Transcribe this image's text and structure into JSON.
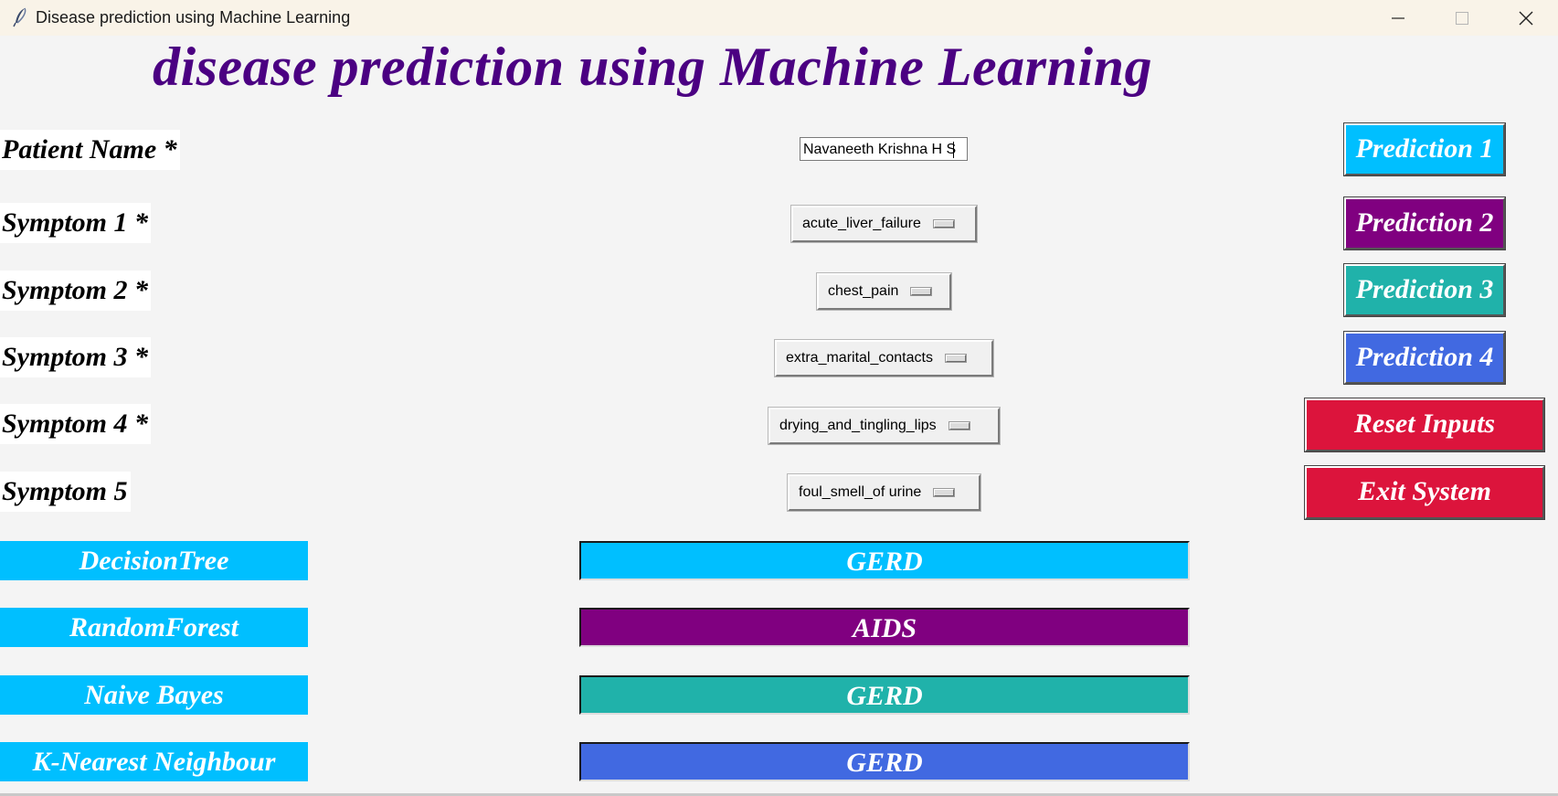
{
  "window": {
    "title": "Disease prediction using Machine Learning",
    "icon": "feather-icon"
  },
  "heading": "disease prediction using Machine Learning",
  "form": {
    "patient_name_label": "Patient Name *",
    "patient_name_value": "Navaneeth Krishna H S",
    "symptoms": [
      {
        "label": "Symptom 1 *",
        "value": "acute_liver_failure"
      },
      {
        "label": "Symptom 2 *",
        "value": "chest_pain"
      },
      {
        "label": "Symptom 3 *",
        "value": "extra_marital_contacts"
      },
      {
        "label": "Symptom 4 *",
        "value": "drying_and_tingling_lips"
      },
      {
        "label": "Symptom 5",
        "value": "foul_smell_of urine"
      }
    ]
  },
  "buttons": {
    "prediction1": "Prediction 1",
    "prediction2": "Prediction 2",
    "prediction3": "Prediction 3",
    "prediction4": "Prediction 4",
    "reset": "Reset Inputs",
    "exit": "Exit System"
  },
  "results": [
    {
      "algorithm": "DecisionTree",
      "prediction": "GERD",
      "color": "#00bfff"
    },
    {
      "algorithm": "RandomForest",
      "prediction": "AIDS",
      "color": "#800080"
    },
    {
      "algorithm": "Naive Bayes",
      "prediction": "GERD",
      "color": "#20b2aa"
    },
    {
      "algorithm": "K-Nearest Neighbour",
      "prediction": "GERD",
      "color": "#4169e1"
    }
  ],
  "colors": {
    "heading": "#4b0082",
    "prediction1": "#00bfff",
    "prediction2": "#800080",
    "prediction3": "#20b2aa",
    "prediction4": "#4169e1",
    "reset": "#dc143c",
    "exit": "#dc143c",
    "algo_label_bg": "#00bfff"
  }
}
